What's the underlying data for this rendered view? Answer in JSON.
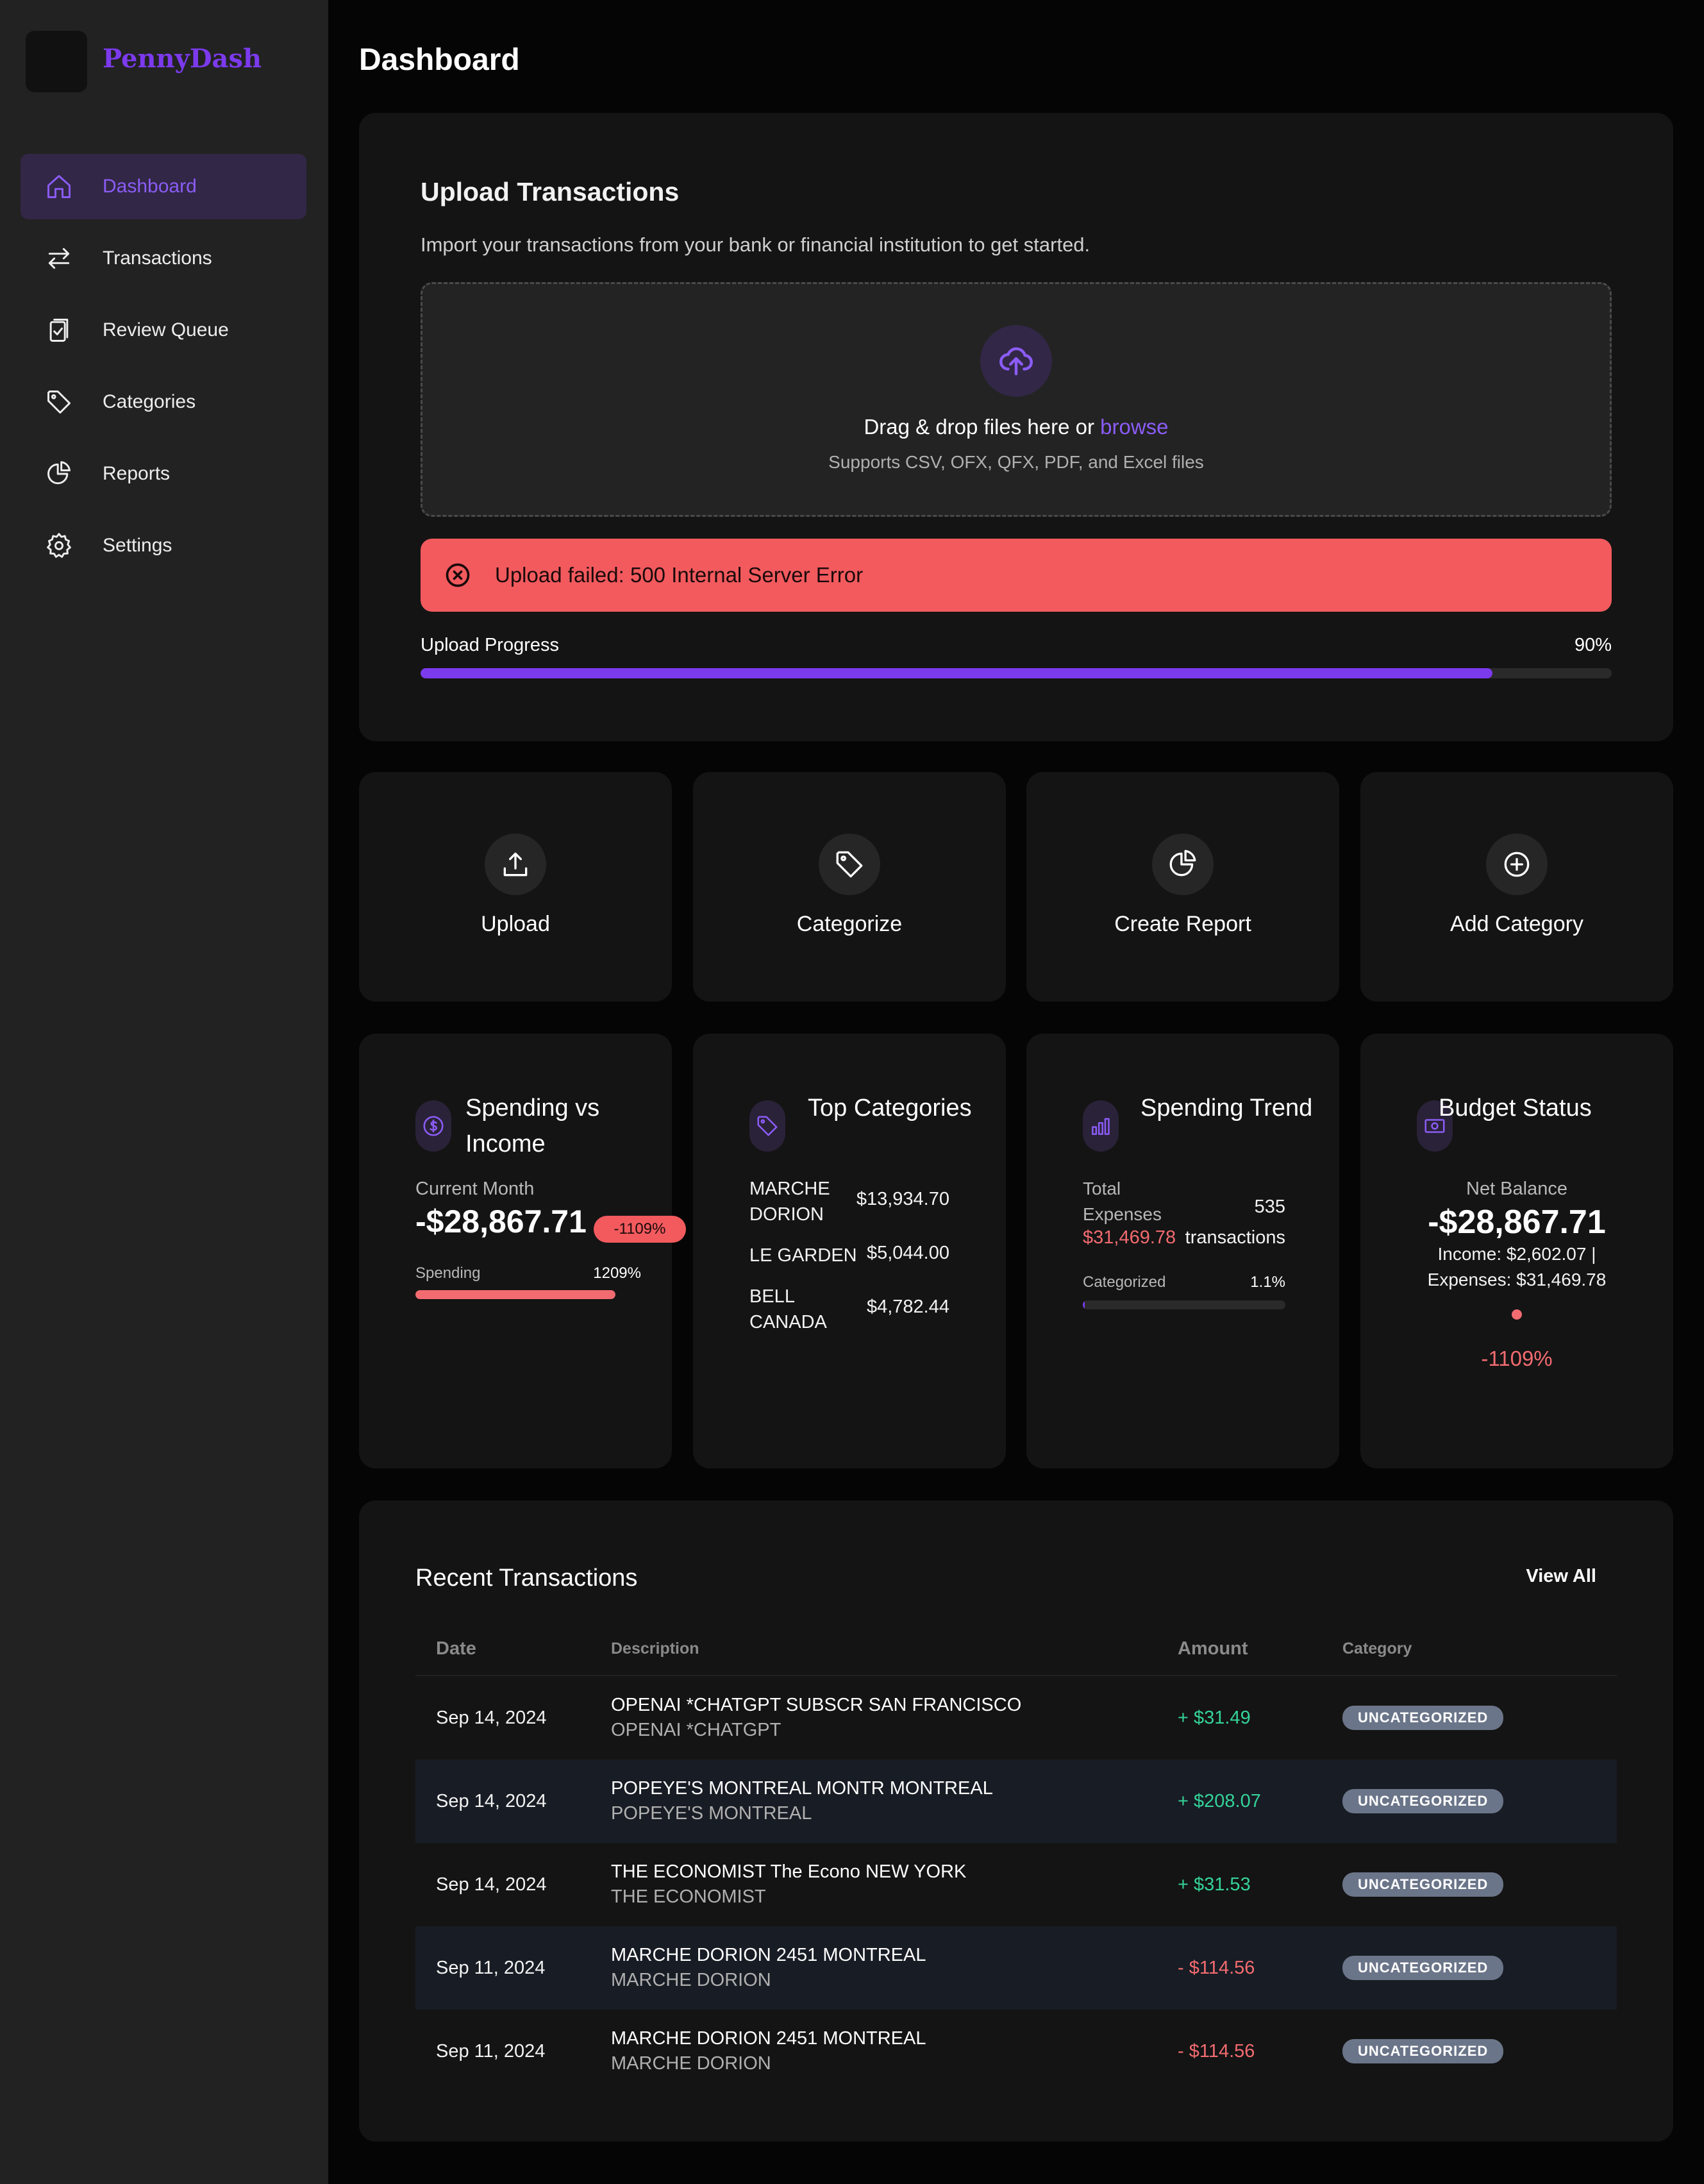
{
  "app": {
    "name": "PennyDash"
  },
  "sidebar": {
    "items": [
      {
        "label": "Dashboard",
        "icon": "home-icon",
        "active": true
      },
      {
        "label": "Transactions",
        "icon": "swap-arrows-icon"
      },
      {
        "label": "Review Queue",
        "icon": "clipboard-check-icon"
      },
      {
        "label": "Categories",
        "icon": "tag-icon"
      },
      {
        "label": "Reports",
        "icon": "pie-chart-icon"
      },
      {
        "label": "Settings",
        "icon": "gear-icon"
      }
    ]
  },
  "page": {
    "title": "Dashboard"
  },
  "upload": {
    "title": "Upload Transactions",
    "subtitle": "Import your transactions from your bank or financial institution to get started.",
    "drop_text": "Drag & drop files here or",
    "browse": "browse",
    "formats": "Supports CSV, OFX, QFX, PDF, and Excel files",
    "error": "Upload failed: 500 Internal Server Error",
    "progress_label": "Upload Progress",
    "progress_text": "90%",
    "progress_fraction": 0.9
  },
  "quick_actions": [
    {
      "label": "Upload",
      "icon": "upload-icon"
    },
    {
      "label": "Categorize",
      "icon": "tag-icon"
    },
    {
      "label": "Create Report",
      "icon": "pie-chart-icon"
    },
    {
      "label": "Add Category",
      "icon": "plus-circle-icon"
    }
  ],
  "spending_income": {
    "title": "Spending vs Income",
    "period": "Current Month",
    "value": "-$28,867.71",
    "badge": "-1109%",
    "bar_label": "Spending",
    "bar_value": "1209%",
    "bar_fraction": 1.0
  },
  "top_categories": {
    "title": "Top Categories",
    "items": [
      {
        "name": "MARCHE DORION",
        "amount": "$13,934.70"
      },
      {
        "name": "LE GARDEN",
        "amount": "$5,044.00"
      },
      {
        "name": "BELL CANADA",
        "amount": "$4,782.44"
      }
    ]
  },
  "spending_trend": {
    "title": "Spending Trend",
    "total_label": "Total Expenses",
    "total_value": "$31,469.78",
    "count": "535",
    "count_label": "transactions",
    "bar_label": "Categorized",
    "bar_value": "1.1%",
    "bar_fraction": 0.011
  },
  "budget": {
    "title": "Budget Status",
    "label": "Net Balance",
    "value": "-$28,867.71",
    "income": "Income: $2,602.07 |",
    "expenses": "Expenses: $31,469.78",
    "percent": "-1109%"
  },
  "transactions": {
    "title": "Recent Transactions",
    "view_all": "View All",
    "columns": [
      "Date",
      "Description",
      "Amount",
      "Category"
    ],
    "rows": [
      {
        "date": "Sep 14, 2024",
        "desc": "OPENAI *CHATGPT SUBSCR SAN FRANCISCO",
        "sub": "OPENAI *CHATGPT",
        "amount": "+ $31.49",
        "category": "UNCATEGORIZED"
      },
      {
        "date": "Sep 14, 2024",
        "desc": "POPEYE'S MONTREAL MONTR MONTREAL",
        "sub": "POPEYE'S MONTREAL",
        "amount": "+ $208.07",
        "category": "UNCATEGORIZED"
      },
      {
        "date": "Sep 14, 2024",
        "desc": "THE ECONOMIST The Econo NEW YORK",
        "sub": "THE ECONOMIST",
        "amount": "+ $31.53",
        "category": "UNCATEGORIZED"
      },
      {
        "date": "Sep 11, 2024",
        "desc": "MARCHE DORION 2451 MONTREAL",
        "sub": "MARCHE DORION",
        "amount": "- $114.56",
        "category": "UNCATEGORIZED"
      },
      {
        "date": "Sep 11, 2024",
        "desc": "MARCHE DORION 2451 MONTREAL",
        "sub": "MARCHE DORION",
        "amount": "- $114.56",
        "category": "UNCATEGORIZED"
      }
    ]
  },
  "colors": {
    "accent": "#7c3aed",
    "error": "#f25a5e",
    "positive": "#34d399",
    "negative": "#f26b70",
    "badge": "#6b7589"
  }
}
